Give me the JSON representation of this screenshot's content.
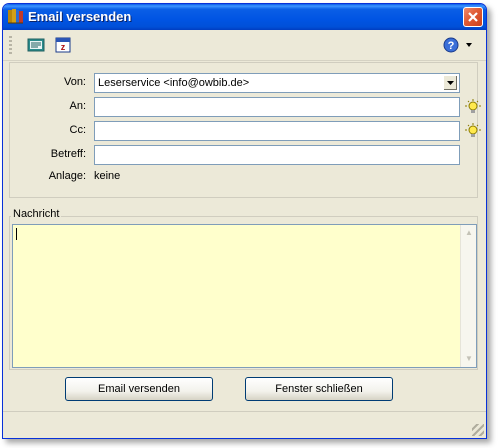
{
  "window": {
    "title": "Email versenden"
  },
  "form": {
    "von_label": "Von:",
    "von_value": "Leserservice <info@owbib.de>",
    "an_label": "An:",
    "an_value": "",
    "cc_label": "Cc:",
    "cc_value": "",
    "betreff_label": "Betreff:",
    "betreff_value": "",
    "anlage_label": "Anlage:",
    "anlage_value": "keine"
  },
  "message": {
    "caption": "Nachricht",
    "value": ""
  },
  "buttons": {
    "send": "Email versenden",
    "close": "Fenster schließen"
  },
  "icons": {
    "title": "book-icon",
    "toolbar": [
      "address-book-icon",
      "calendar-icon"
    ],
    "help": "help-icon",
    "suggest": "lightbulb-icon"
  },
  "colors": {
    "titlebar": "#0054e3",
    "message_background": "#ffffcc",
    "window_background": "#ece9d8"
  }
}
